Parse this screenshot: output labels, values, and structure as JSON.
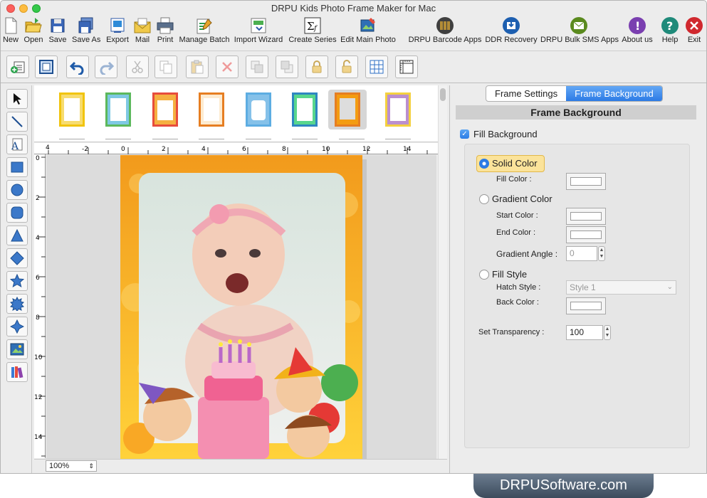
{
  "window": {
    "title": "DRPU Kids Photo Frame Maker for Mac"
  },
  "toolbar": {
    "new": "New",
    "open": "Open",
    "save": "Save",
    "save_as": "Save As",
    "export": "Export",
    "mail": "Mail",
    "print": "Print",
    "manage_batch": "Manage Batch",
    "import_wizard": "Import Wizard",
    "create_series": "Create Series",
    "edit_main_photo": "Edit Main Photo",
    "barcode_apps": "DRPU Barcode Apps",
    "ddr_recovery": "DDR Recovery",
    "bulk_sms": "DRPU Bulk SMS Apps",
    "about": "About us",
    "help": "Help",
    "exit": "Exit"
  },
  "ruler": {
    "h_ticks": [
      "4",
      "-2",
      "0",
      "2",
      "4",
      "6",
      "8",
      "10",
      "12",
      "14"
    ],
    "v_ticks": [
      "0",
      "2",
      "4",
      "6",
      "8",
      "10",
      "12",
      "14"
    ]
  },
  "zoom": {
    "value": "100%"
  },
  "panel": {
    "tabs": [
      "Frame Settings",
      "Frame Background"
    ],
    "active_tab": "Frame Background",
    "heading": "Frame Background",
    "fill_background": {
      "label": "Fill Background",
      "checked": true
    },
    "solid_color": {
      "label": "Solid Color",
      "selected": true,
      "fill_color_label": "Fill Color :"
    },
    "gradient_color": {
      "label": "Gradient Color",
      "start_label": "Start Color :",
      "end_label": "End Color :",
      "angle_label": "Gradient Angle :",
      "angle_value": "0"
    },
    "fill_style": {
      "label": "Fill Style",
      "hatch_label": "Hatch Style :",
      "hatch_value": "Style 1",
      "back_label": "Back Color :"
    },
    "transparency": {
      "label": "Set Transparency :",
      "value": "100"
    }
  },
  "branding": "DRPUSoftware.com",
  "colors": {
    "accent": "#2c7be5",
    "frame_orange": "#f29a1c",
    "frame_yellow": "#ffd23a"
  }
}
